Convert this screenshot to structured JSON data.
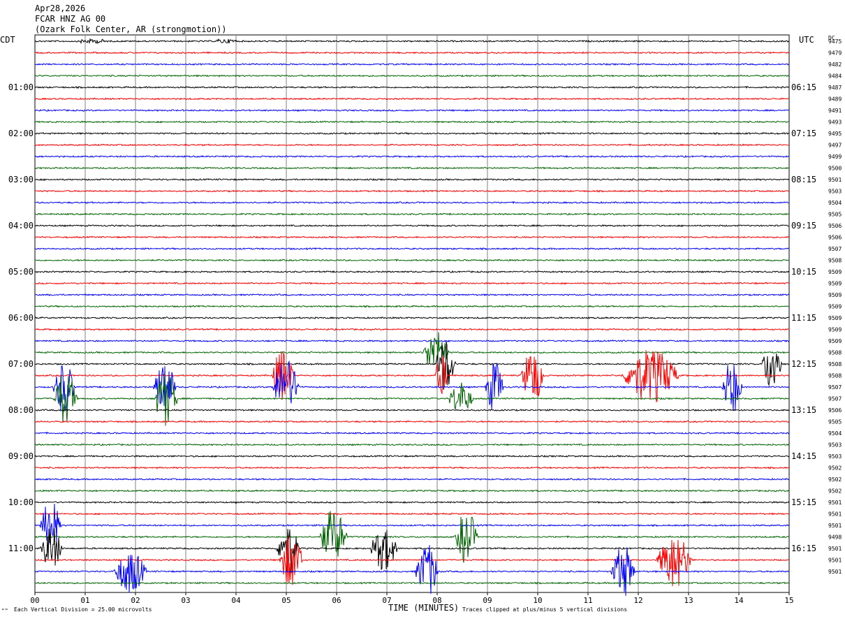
{
  "header": {
    "date": "Apr28,2026",
    "channel": "FCAR HNZ AG 00",
    "station": "(Ozark Folk Center, AR (strongmotion))"
  },
  "left_zone": "CDT",
  "right_zone": "UTC",
  "dc_label": "DC",
  "footer": {
    "scale": "Each Vertical Division =   25.00 microvolts",
    "clip": "Traces clipped at plus/minus 5 vertical divisions",
    "marker": "\"\""
  },
  "chart_data": {
    "type": "line",
    "title": "FCAR HNZ AG 00",
    "xlabel": "TIME (MINUTES)",
    "ylabel": "",
    "xlim": [
      0,
      15
    ],
    "x_ticks": [
      "00",
      "01",
      "02",
      "03",
      "04",
      "05",
      "06",
      "07",
      "08",
      "09",
      "10",
      "11",
      "12",
      "13",
      "14",
      "15"
    ],
    "trace_count": 48,
    "trace_colors": [
      "#000000",
      "#ff0000",
      "#0000ff",
      "#006400"
    ],
    "left_time_labels": [
      {
        "trace": 4,
        "label": "01:00"
      },
      {
        "trace": 8,
        "label": "02:00"
      },
      {
        "trace": 12,
        "label": "03:00"
      },
      {
        "trace": 16,
        "label": "04:00"
      },
      {
        "trace": 20,
        "label": "05:00"
      },
      {
        "trace": 24,
        "label": "06:00"
      },
      {
        "trace": 28,
        "label": "07:00"
      },
      {
        "trace": 32,
        "label": "08:00"
      },
      {
        "trace": 36,
        "label": "09:00"
      },
      {
        "trace": 40,
        "label": "10:00"
      },
      {
        "trace": 44,
        "label": "11:00"
      }
    ],
    "right_time_labels": [
      {
        "trace": 4,
        "label": "06:15"
      },
      {
        "trace": 8,
        "label": "07:15"
      },
      {
        "trace": 12,
        "label": "08:15"
      },
      {
        "trace": 16,
        "label": "09:15"
      },
      {
        "trace": 20,
        "label": "10:15"
      },
      {
        "trace": 24,
        "label": "11:15"
      },
      {
        "trace": 28,
        "label": "12:15"
      },
      {
        "trace": 32,
        "label": "13:15"
      },
      {
        "trace": 36,
        "label": "14:15"
      },
      {
        "trace": 40,
        "label": "15:15"
      },
      {
        "trace": 44,
        "label": "16:15"
      }
    ],
    "dc_offsets": [
      "9475",
      "9479",
      "9482",
      "9484",
      "9487",
      "9489",
      "9491",
      "9493",
      "9495",
      "9497",
      "9499",
      "9500",
      "9501",
      "9503",
      "9504",
      "9505",
      "9506",
      "9506",
      "9507",
      "9508",
      "9509",
      "9509",
      "9509",
      "9509",
      "9509",
      "9509",
      "9509",
      "9508",
      "9508",
      "9508",
      "9507",
      "9507",
      "9506",
      "9505",
      "9504",
      "9503",
      "9503",
      "9502",
      "9502",
      "9502",
      "9501",
      "9501",
      "9501",
      "9498",
      "9501",
      "9501",
      "9501"
    ],
    "events": [
      {
        "trace": 30,
        "start_min": 0.35,
        "end_min": 0.95,
        "amp_div": 5
      },
      {
        "trace": 31,
        "start_min": 0.35,
        "end_min": 1.0,
        "amp_div": 5
      },
      {
        "trace": 30,
        "start_min": 2.35,
        "end_min": 2.95,
        "amp_div": 5
      },
      {
        "trace": 31,
        "start_min": 2.35,
        "end_min": 3.0,
        "amp_div": 5
      },
      {
        "trace": 29,
        "start_min": 4.7,
        "end_min": 5.3,
        "amp_div": 5
      },
      {
        "trace": 30,
        "start_min": 4.7,
        "end_min": 5.45,
        "amp_div": 5
      },
      {
        "trace": 27,
        "start_min": 7.7,
        "end_min": 8.4,
        "amp_div": 4
      },
      {
        "trace": 28,
        "start_min": 7.95,
        "end_min": 8.5,
        "amp_div": 5
      },
      {
        "trace": 29,
        "start_min": 7.95,
        "end_min": 8.3,
        "amp_div": 4
      },
      {
        "trace": 31,
        "start_min": 8.2,
        "end_min": 8.9,
        "amp_div": 3
      },
      {
        "trace": 30,
        "start_min": 8.95,
        "end_min": 9.45,
        "amp_div": 5
      },
      {
        "trace": 29,
        "start_min": 9.65,
        "end_min": 10.3,
        "amp_div": 5
      },
      {
        "trace": 29,
        "start_min": 11.65,
        "end_min": 13.2,
        "amp_div": 5
      },
      {
        "trace": 30,
        "start_min": 13.65,
        "end_min": 14.2,
        "amp_div": 5
      },
      {
        "trace": 28,
        "start_min": 14.45,
        "end_min": 15.0,
        "amp_div": 5
      },
      {
        "trace": 42,
        "start_min": 0.1,
        "end_min": 0.65,
        "amp_div": 5
      },
      {
        "trace": 44,
        "start_min": 0.1,
        "end_min": 0.7,
        "amp_div": 4
      },
      {
        "trace": 46,
        "start_min": 1.55,
        "end_min": 2.45,
        "amp_div": 4
      },
      {
        "trace": 44,
        "start_min": 4.8,
        "end_min": 5.4,
        "amp_div": 5
      },
      {
        "trace": 45,
        "start_min": 4.85,
        "end_min": 5.5,
        "amp_div": 5
      },
      {
        "trace": 43,
        "start_min": 5.65,
        "end_min": 6.4,
        "amp_div": 5
      },
      {
        "trace": 44,
        "start_min": 6.65,
        "end_min": 7.4,
        "amp_div": 4
      },
      {
        "trace": 46,
        "start_min": 7.55,
        "end_min": 8.2,
        "amp_div": 5
      },
      {
        "trace": 43,
        "start_min": 8.35,
        "end_min": 8.95,
        "amp_div": 5
      },
      {
        "trace": 46,
        "start_min": 11.45,
        "end_min": 12.1,
        "amp_div": 5
      },
      {
        "trace": 45,
        "start_min": 12.35,
        "end_min": 13.3,
        "amp_div": 5
      }
    ]
  }
}
